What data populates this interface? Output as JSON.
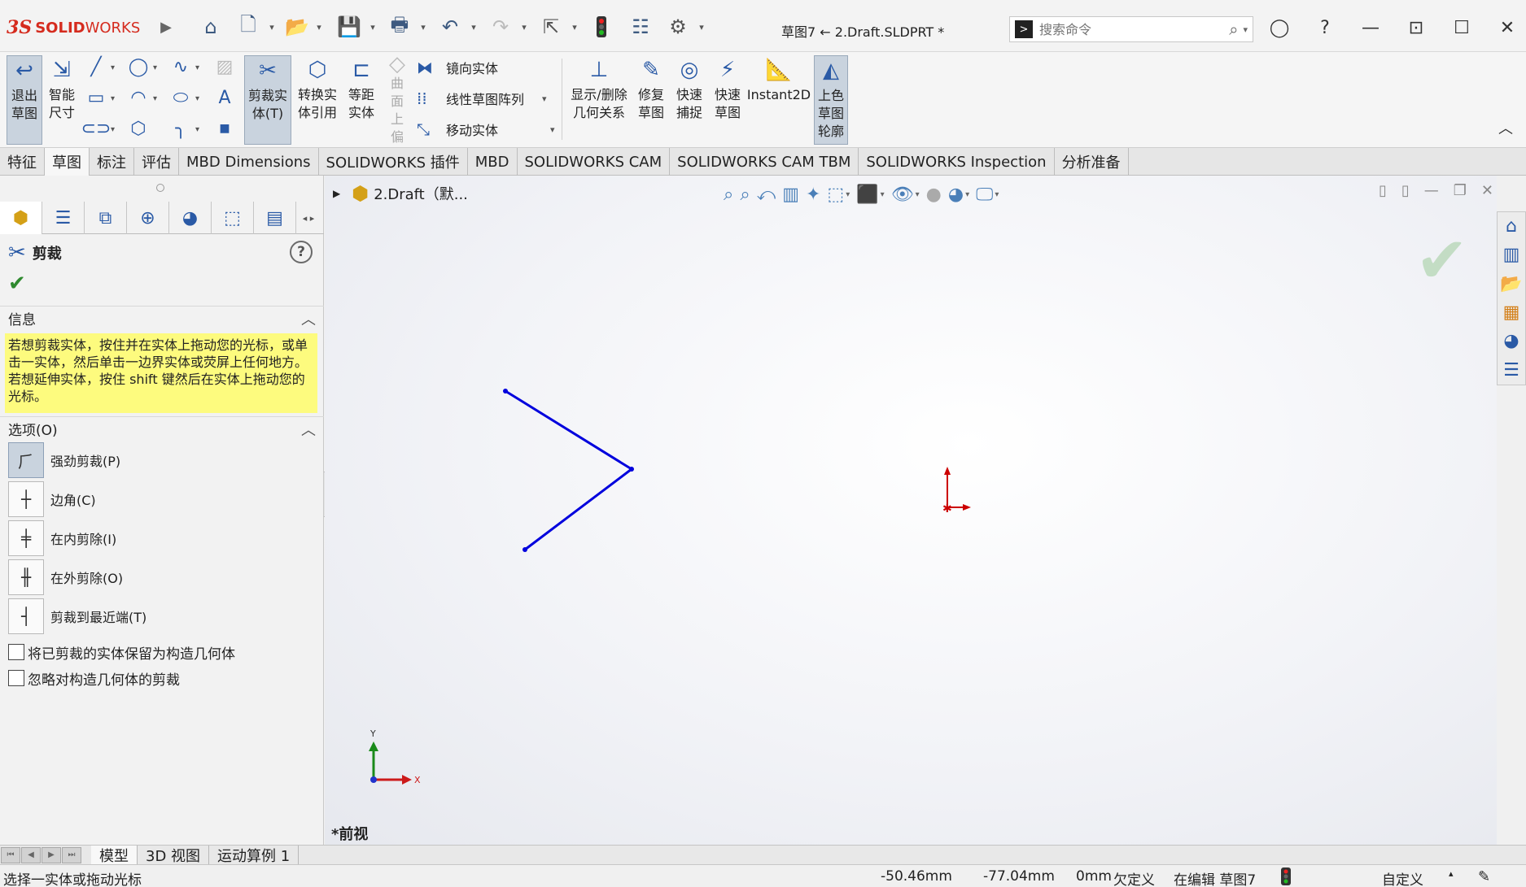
{
  "app": {
    "brand_ds": "3S",
    "brand_solid": "SOLID",
    "brand_works": "WORKS",
    "document_title": "草图7 ← 2.Draft.SLDPRT *"
  },
  "search": {
    "placeholder": "搜索命令"
  },
  "colors": {
    "accent": "#2a5aa6",
    "sketch_line": "#0000dd",
    "origin_red": "#cc0000",
    "info_bg": "#fdfb7e",
    "brand_red": "#d52b1e"
  },
  "ribbon": {
    "exit_sketch": "退出草图",
    "smart_dimension": "智能尺寸",
    "trim": "剪裁实体(T)",
    "convert": "转换实体引用",
    "offset": "等距实体",
    "surface_offset": "曲面上偏移",
    "mirror": "镜向实体",
    "linear_pattern": "线性草图阵列",
    "move": "移动实体",
    "display_relations": "显示/删除几何关系",
    "repair": "修复草图",
    "quick_snaps": "快速捕捉",
    "rapid_sketch": "快速草图",
    "instant2d": "Instant2D",
    "shaded_contours": "上色草图轮廓"
  },
  "tabs": [
    "特征",
    "草图",
    "标注",
    "评估",
    "MBD Dimensions",
    "SOLIDWORKS 插件",
    "MBD",
    "SOLIDWORKS CAM",
    "SOLIDWORKS CAM TBM",
    "SOLIDWORKS Inspection",
    "分析准备"
  ],
  "property_manager": {
    "title": "剪裁",
    "info_header": "信息",
    "info_text": "若想剪裁实体，按住并在实体上拖动您的光标，或单击一实体，然后单击一边界实体或荧屏上任何地方。若想延伸实体，按住 shift 键然后在实体上拖动您的光标。",
    "options_header": "选项(O)",
    "options": [
      "强劲剪裁(P)",
      "边角(C)",
      "在内剪除(I)",
      "在外剪除(O)",
      "剪裁到最近端(T)"
    ],
    "checkboxes": [
      "将已剪裁的实体保留为构造几何体",
      "忽略对构造几何体的剪裁"
    ]
  },
  "graphics": {
    "tree_root": "2.Draft（默...",
    "view_name": "*前视",
    "triad_x": "X",
    "triad_y": "Y"
  },
  "bottom_tabs": [
    "模型",
    "3D 视图",
    "运动算例 1"
  ],
  "status": {
    "message": "选择一实体或拖动光标",
    "x": "-50.46mm",
    "y": "-77.04mm",
    "z": "0mm",
    "definition": "欠定义",
    "editing": "在编辑 草图7",
    "units": "自定义"
  }
}
